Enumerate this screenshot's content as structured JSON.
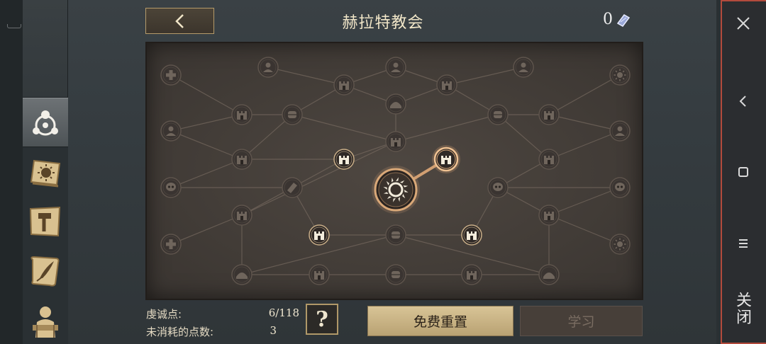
{
  "header": {
    "title": "赫拉特教会",
    "currency_value": "0",
    "currency_icon": "crystal-icon",
    "back_icon": "chevron-left-icon"
  },
  "tabs": [
    {
      "icon": "faction-emblem-icon",
      "active": true
    },
    {
      "icon": "sun-book-icon",
      "active": false
    },
    {
      "icon": "hammer-scroll-icon",
      "active": false
    },
    {
      "icon": "quill-scroll-icon",
      "active": false
    },
    {
      "icon": "character-silhouette-icon",
      "active": false
    }
  ],
  "board": {
    "center_icon": "sun-ring-icon",
    "node_icons": [
      "tower-icon",
      "cross-shield-icon",
      "skull-icon",
      "bust-icon",
      "sun-icon",
      "book-icon",
      "bread-icon",
      "fist-icon"
    ]
  },
  "stats": {
    "devotion_label": "虔诚点:",
    "devotion_value": "6/118",
    "unspent_label": "未消耗的点数:",
    "unspent_value": "3"
  },
  "buttons": {
    "help_label": "?",
    "reset_label": "免费重置",
    "learn_label": "学习"
  },
  "side_panel": {
    "close_label": "关闭",
    "items": [
      "close-icon",
      "chevron-left-icon",
      "square-icon",
      "menu-icon"
    ]
  },
  "colors": {
    "accent_gold": "#d8c496",
    "node_highlight": "#e0a878",
    "side_border": "#b34a3c"
  }
}
